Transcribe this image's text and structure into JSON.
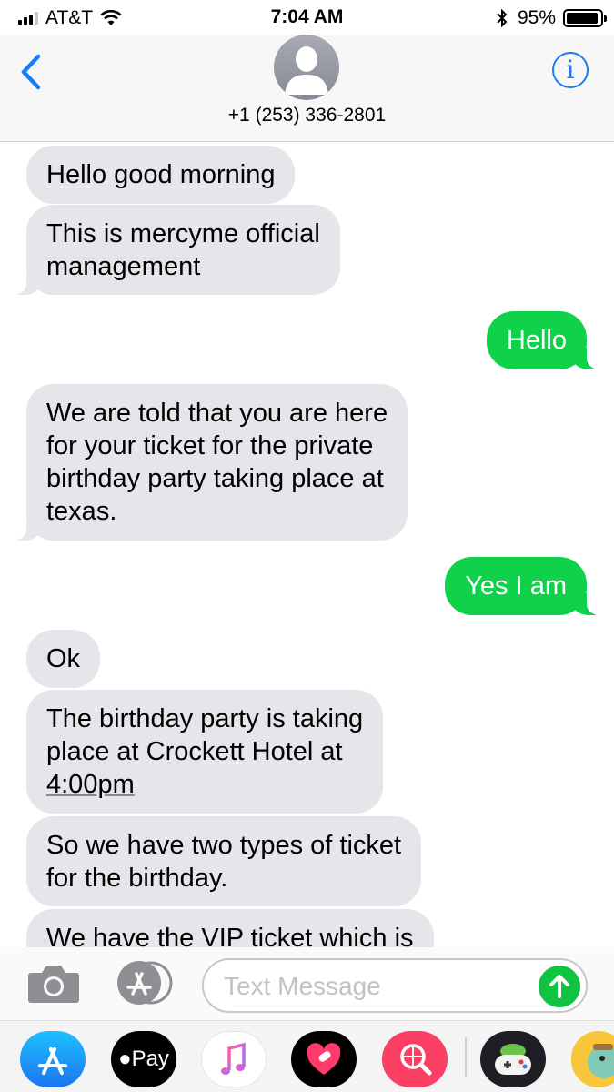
{
  "status_bar": {
    "carrier": "AT&T",
    "time": "7:04 AM",
    "battery_percent": "95%",
    "battery_level": 0.95,
    "signal_bars": 3,
    "icons": [
      "signal-icon",
      "wifi-icon",
      "bluetooth-icon",
      "battery-icon"
    ]
  },
  "header": {
    "contact_number": "+1 (253) 336-2801",
    "info_label": "i",
    "icons": [
      "back-chevron-icon",
      "contact-avatar-icon",
      "info-icon"
    ]
  },
  "messages": [
    {
      "direction": "incoming",
      "lines": [
        "Hello good morning"
      ]
    },
    {
      "direction": "incoming",
      "lines": [
        "This is mercyme official",
        "management"
      ]
    },
    {
      "direction": "outgoing",
      "lines": [
        "Hello"
      ]
    },
    {
      "direction": "incoming",
      "lines": [
        "We are told that you are here",
        "for your ticket for the private",
        "birthday party taking place at",
        "texas."
      ]
    },
    {
      "direction": "outgoing",
      "lines": [
        "Yes I am"
      ]
    },
    {
      "direction": "incoming",
      "lines": [
        "Ok"
      ]
    },
    {
      "direction": "incoming",
      "lines": [
        "The birthday party is taking",
        "place at Crockett Hotel at",
        "4:00pm"
      ]
    },
    {
      "direction": "incoming",
      "lines": [
        "So we have two types of ticket",
        "for the birthday."
      ]
    },
    {
      "direction": "incoming",
      "lines": [
        "We have the VIP ticket which is"
      ]
    }
  ],
  "input_bar": {
    "placeholder": "Text Message",
    "value": "",
    "icons": [
      "camera-icon",
      "app-store-icon",
      "send-arrow-icon"
    ]
  },
  "app_drawer": {
    "apps": [
      {
        "name": "App Store",
        "icon": "app-store-icon"
      },
      {
        "name": "Apple Pay",
        "label": "Pay",
        "icon": "apple-pay-icon"
      },
      {
        "name": "Music",
        "icon": "music-note-icon"
      },
      {
        "name": "Digital Touch",
        "icon": "heart-icon"
      },
      {
        "name": "Images Search",
        "icon": "globe-search-icon"
      },
      {
        "name": "Game",
        "icon": "game-controller-icon"
      },
      {
        "name": "Sticker",
        "icon": "character-icon"
      }
    ]
  },
  "colors": {
    "incoming_bubble": "#e5e5ea",
    "outgoing_bubble": "#0fd14a",
    "accent_blue": "#147efb",
    "send_button": "#10c341"
  }
}
